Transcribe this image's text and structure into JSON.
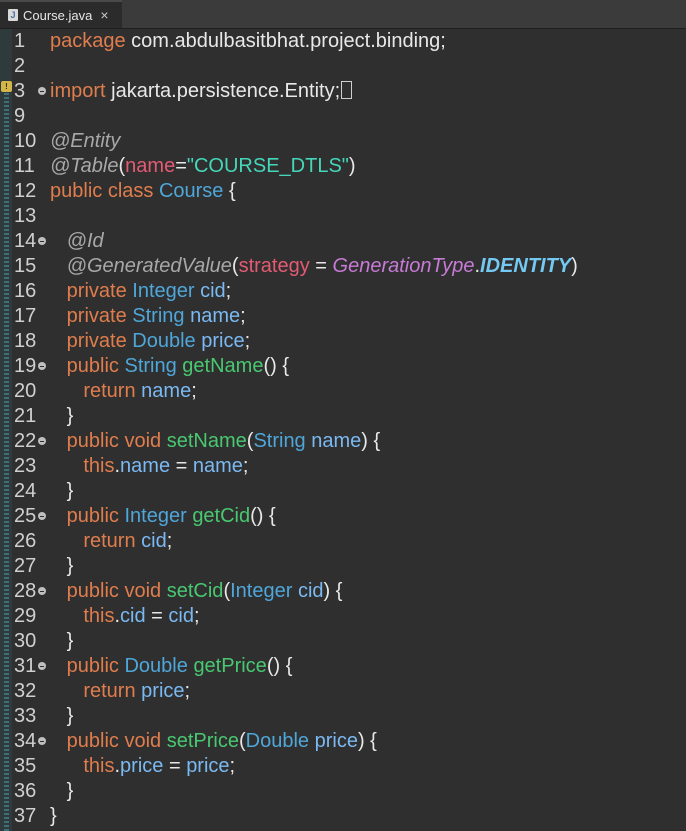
{
  "tab": {
    "filename": "Course.java",
    "close_glyph": "×"
  },
  "lines": [
    {
      "num": "1",
      "fold": false,
      "segs": [
        {
          "t": "package",
          "c": "kw"
        },
        {
          "t": " com.abdulbasitbhat.project.binding;",
          "c": "pl"
        }
      ]
    },
    {
      "num": "2",
      "fold": false,
      "segs": []
    },
    {
      "num": "3",
      "fold": true,
      "segs": [
        {
          "t": "import",
          "c": "kw"
        },
        {
          "t": " jakarta.persistence.Entity;",
          "c": "pl"
        }
      ],
      "caret": true
    },
    {
      "num": "9",
      "fold": false,
      "segs": []
    },
    {
      "num": "10",
      "fold": false,
      "segs": [
        {
          "t": "@Entity",
          "c": "ann"
        }
      ]
    },
    {
      "num": "11",
      "fold": false,
      "segs": [
        {
          "t": "@Table",
          "c": "ann"
        },
        {
          "t": "(",
          "c": "pl"
        },
        {
          "t": "name",
          "c": "param"
        },
        {
          "t": "=",
          "c": "pl"
        },
        {
          "t": "\"COURSE_DTLS\"",
          "c": "str"
        },
        {
          "t": ")",
          "c": "pl"
        }
      ]
    },
    {
      "num": "12",
      "fold": false,
      "segs": [
        {
          "t": "public class ",
          "c": "kw"
        },
        {
          "t": "Course",
          "c": "ty"
        },
        {
          "t": " {",
          "c": "pl"
        }
      ]
    },
    {
      "num": "13",
      "fold": false,
      "segs": []
    },
    {
      "num": "14",
      "fold": true,
      "segs": [
        {
          "t": "   @Id",
          "c": "ann"
        }
      ]
    },
    {
      "num": "15",
      "fold": false,
      "segs": [
        {
          "t": "   @GeneratedValue",
          "c": "ann"
        },
        {
          "t": "(",
          "c": "pl"
        },
        {
          "t": "strategy",
          "c": "param"
        },
        {
          "t": " = ",
          "c": "pl"
        },
        {
          "t": "GenerationType",
          "c": "enumc"
        },
        {
          "t": ".",
          "c": "pl"
        },
        {
          "t": "IDENTITY",
          "c": "enumv"
        },
        {
          "t": ")",
          "c": "pl"
        }
      ]
    },
    {
      "num": "16",
      "fold": false,
      "segs": [
        {
          "t": "   private ",
          "c": "kw"
        },
        {
          "t": "Integer",
          "c": "ty"
        },
        {
          "t": " ",
          "c": "pl"
        },
        {
          "t": "cid",
          "c": "fld"
        },
        {
          "t": ";",
          "c": "pl"
        }
      ]
    },
    {
      "num": "17",
      "fold": false,
      "segs": [
        {
          "t": "   private ",
          "c": "kw"
        },
        {
          "t": "String",
          "c": "ty"
        },
        {
          "t": " ",
          "c": "pl"
        },
        {
          "t": "name",
          "c": "fld"
        },
        {
          "t": ";",
          "c": "pl"
        }
      ]
    },
    {
      "num": "18",
      "fold": false,
      "segs": [
        {
          "t": "   private ",
          "c": "kw"
        },
        {
          "t": "Double",
          "c": "ty"
        },
        {
          "t": " ",
          "c": "pl"
        },
        {
          "t": "price",
          "c": "fld"
        },
        {
          "t": ";",
          "c": "pl"
        }
      ]
    },
    {
      "num": "19",
      "fold": true,
      "segs": [
        {
          "t": "   public ",
          "c": "kw"
        },
        {
          "t": "String",
          "c": "ty"
        },
        {
          "t": " ",
          "c": "pl"
        },
        {
          "t": "getName",
          "c": "met"
        },
        {
          "t": "() {",
          "c": "pl"
        }
      ]
    },
    {
      "num": "20",
      "fold": false,
      "segs": [
        {
          "t": "      return ",
          "c": "kw"
        },
        {
          "t": "name",
          "c": "fld"
        },
        {
          "t": ";",
          "c": "pl"
        }
      ]
    },
    {
      "num": "21",
      "fold": false,
      "segs": [
        {
          "t": "   }",
          "c": "pl"
        }
      ]
    },
    {
      "num": "22",
      "fold": true,
      "segs": [
        {
          "t": "   public void ",
          "c": "kw"
        },
        {
          "t": "setName",
          "c": "met"
        },
        {
          "t": "(",
          "c": "pl"
        },
        {
          "t": "String",
          "c": "ty"
        },
        {
          "t": " ",
          "c": "pl"
        },
        {
          "t": "name",
          "c": "fld"
        },
        {
          "t": ") {",
          "c": "pl"
        }
      ]
    },
    {
      "num": "23",
      "fold": false,
      "segs": [
        {
          "t": "      this",
          "c": "kw"
        },
        {
          "t": ".",
          "c": "pl"
        },
        {
          "t": "name",
          "c": "fld"
        },
        {
          "t": " = ",
          "c": "pl"
        },
        {
          "t": "name",
          "c": "fld"
        },
        {
          "t": ";",
          "c": "pl"
        }
      ]
    },
    {
      "num": "24",
      "fold": false,
      "segs": [
        {
          "t": "   }",
          "c": "pl"
        }
      ]
    },
    {
      "num": "25",
      "fold": true,
      "segs": [
        {
          "t": "   public ",
          "c": "kw"
        },
        {
          "t": "Integer",
          "c": "ty"
        },
        {
          "t": " ",
          "c": "pl"
        },
        {
          "t": "getCid",
          "c": "met"
        },
        {
          "t": "() {",
          "c": "pl"
        }
      ]
    },
    {
      "num": "26",
      "fold": false,
      "segs": [
        {
          "t": "      return ",
          "c": "kw"
        },
        {
          "t": "cid",
          "c": "fld"
        },
        {
          "t": ";",
          "c": "pl"
        }
      ]
    },
    {
      "num": "27",
      "fold": false,
      "segs": [
        {
          "t": "   }",
          "c": "pl"
        }
      ]
    },
    {
      "num": "28",
      "fold": true,
      "segs": [
        {
          "t": "   public void ",
          "c": "kw"
        },
        {
          "t": "setCid",
          "c": "met"
        },
        {
          "t": "(",
          "c": "pl"
        },
        {
          "t": "Integer",
          "c": "ty"
        },
        {
          "t": " ",
          "c": "pl"
        },
        {
          "t": "cid",
          "c": "fld"
        },
        {
          "t": ") {",
          "c": "pl"
        }
      ]
    },
    {
      "num": "29",
      "fold": false,
      "segs": [
        {
          "t": "      this",
          "c": "kw"
        },
        {
          "t": ".",
          "c": "pl"
        },
        {
          "t": "cid",
          "c": "fld"
        },
        {
          "t": " = ",
          "c": "pl"
        },
        {
          "t": "cid",
          "c": "fld"
        },
        {
          "t": ";",
          "c": "pl"
        }
      ]
    },
    {
      "num": "30",
      "fold": false,
      "segs": [
        {
          "t": "   }",
          "c": "pl"
        }
      ]
    },
    {
      "num": "31",
      "fold": true,
      "segs": [
        {
          "t": "   public ",
          "c": "kw"
        },
        {
          "t": "Double",
          "c": "ty"
        },
        {
          "t": " ",
          "c": "pl"
        },
        {
          "t": "getPrice",
          "c": "met"
        },
        {
          "t": "() {",
          "c": "pl"
        }
      ]
    },
    {
      "num": "32",
      "fold": false,
      "segs": [
        {
          "t": "      return ",
          "c": "kw"
        },
        {
          "t": "price",
          "c": "fld"
        },
        {
          "t": ";",
          "c": "pl"
        }
      ]
    },
    {
      "num": "33",
      "fold": false,
      "segs": [
        {
          "t": "   }",
          "c": "pl"
        }
      ]
    },
    {
      "num": "34",
      "fold": true,
      "segs": [
        {
          "t": "   public void ",
          "c": "kw"
        },
        {
          "t": "setPrice",
          "c": "met"
        },
        {
          "t": "(",
          "c": "pl"
        },
        {
          "t": "Double",
          "c": "ty"
        },
        {
          "t": " ",
          "c": "pl"
        },
        {
          "t": "price",
          "c": "fld"
        },
        {
          "t": ") {",
          "c": "pl"
        }
      ]
    },
    {
      "num": "35",
      "fold": false,
      "segs": [
        {
          "t": "      this",
          "c": "kw"
        },
        {
          "t": ".",
          "c": "pl"
        },
        {
          "t": "price",
          "c": "fld"
        },
        {
          "t": " = ",
          "c": "pl"
        },
        {
          "t": "price",
          "c": "fld"
        },
        {
          "t": ";",
          "c": "pl"
        }
      ]
    },
    {
      "num": "36",
      "fold": false,
      "segs": [
        {
          "t": "   }",
          "c": "pl"
        }
      ]
    },
    {
      "num": "37",
      "fold": false,
      "segs": [
        {
          "t": "}",
          "c": "pl"
        }
      ]
    }
  ]
}
